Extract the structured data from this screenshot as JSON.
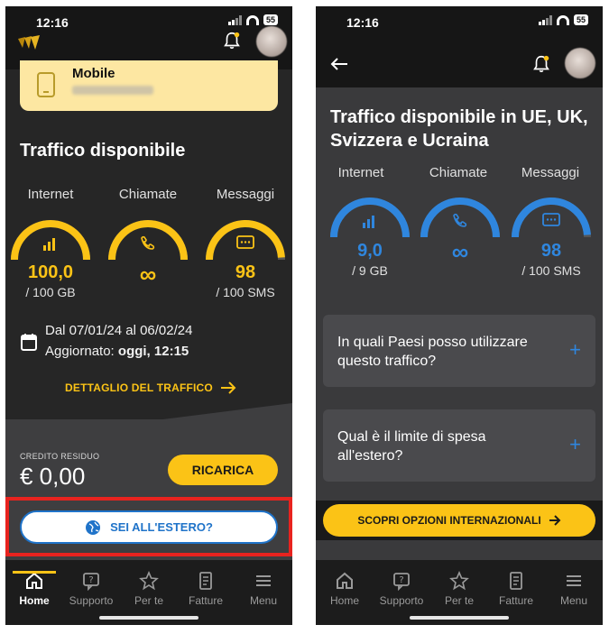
{
  "left": {
    "status": {
      "time": "12:16",
      "battery": "55"
    },
    "mobile_card": {
      "title": "Mobile"
    },
    "section_title": "Traffico disponibile",
    "columns": [
      {
        "label": "Internet",
        "value": "100,0",
        "unit": "/ 100 GB",
        "fill": 1.0
      },
      {
        "label": "Chiamate",
        "value": "∞",
        "unit": "",
        "fill": 1.0
      },
      {
        "label": "Messaggi",
        "value": "98",
        "unit": "/ 100 SMS",
        "fill": 0.98
      }
    ],
    "period": "Dal 07/01/24 al 06/02/24",
    "updated_prefix": "Aggiornato:",
    "updated_value": "oggi, 12:15",
    "detail_link": "DETTAGLIO DEL TRAFFICO",
    "credit_label": "CREDITO RESIDUO",
    "credit_value": "€ 0,00",
    "recharge_button": "RICARICA",
    "abroad_button": "SEI ALL'ESTERO?",
    "nav": [
      "Home",
      "Supporto",
      "Per te",
      "Fatture",
      "Menu"
    ],
    "accent_color": "#fbc316"
  },
  "right": {
    "status": {
      "time": "12:16",
      "battery": "55"
    },
    "section_title": "Traffico disponibile in UE, UK, Svizzera e Ucraina",
    "columns": [
      {
        "label": "Internet",
        "value": "9,0",
        "unit": "/ 9 GB",
        "fill": 1.0
      },
      {
        "label": "Chiamate",
        "value": "∞",
        "unit": "",
        "fill": 1.0
      },
      {
        "label": "Messaggi",
        "value": "98",
        "unit": "/ 100 SMS",
        "fill": 0.98
      }
    ],
    "faq": [
      {
        "question": "In quali Paesi posso utilizzare questo traffico?"
      },
      {
        "question": "Qual è il limite di spesa all'estero?"
      }
    ],
    "intl_button": "SCOPRI OPZIONI INTERNAZIONALI",
    "nav": [
      "Home",
      "Supporto",
      "Per te",
      "Fatture",
      "Menu"
    ],
    "accent_color": "#2f86de"
  }
}
